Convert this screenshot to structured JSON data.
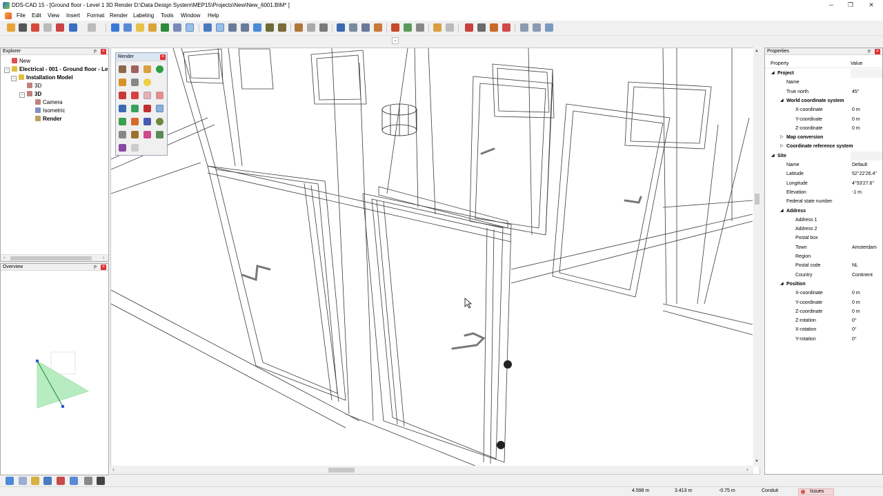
{
  "window": {
    "title": "DDS-CAD 15 - [Ground floor - Level 1  3D  Render  D:\\Data Design System\\MEP15\\Projects\\New\\New_6001.BIM* ]",
    "controls": [
      "─",
      "❐",
      "✕"
    ]
  },
  "menu": [
    "File",
    "Edit",
    "View",
    "Insert",
    "Format",
    "Render",
    "Labeling",
    "Tools",
    "Window",
    "Help"
  ],
  "explorer": {
    "title": "Explorer",
    "tree": [
      {
        "label": "New",
        "level": 0,
        "icon": "new-project-icon"
      },
      {
        "label": "Electrical - 001 - Ground floor - Le",
        "level": 0,
        "icon": "electrical-model-icon",
        "bold": true
      },
      {
        "label": "Installation Model",
        "level": 1,
        "icon": "installation-model-icon",
        "bold": true
      },
      {
        "label": "3D",
        "level": 2,
        "icon": "view-3d-icon"
      },
      {
        "label": "3D",
        "level": 2,
        "icon": "view-3d-icon",
        "bold": true
      },
      {
        "label": "Camera",
        "level": 3,
        "icon": "camera-icon"
      },
      {
        "label": "Isometric",
        "level": 3,
        "icon": "isometric-icon"
      },
      {
        "label": "Render",
        "level": 3,
        "icon": "render-icon",
        "bold": true
      }
    ]
  },
  "overview": {
    "title": "Overview"
  },
  "render_palette": {
    "title": "Render"
  },
  "properties": {
    "title": "Properties",
    "col_property": "Property",
    "col_value": "Value",
    "rows": [
      {
        "label": "Project",
        "level": 0,
        "section": true,
        "value": ""
      },
      {
        "label": "Name",
        "level": 1,
        "value": ""
      },
      {
        "label": "True north",
        "level": 1,
        "value": "45°"
      },
      {
        "label": "World coordinate system",
        "level": 1,
        "section": true,
        "value": ""
      },
      {
        "label": "X-coordinate",
        "level": 2,
        "value": "0 m"
      },
      {
        "label": "Y-coordinate",
        "level": 2,
        "value": "0 m"
      },
      {
        "label": "Z-coordinate",
        "level": 2,
        "value": "0 m"
      },
      {
        "label": "Map conversion",
        "level": 1,
        "section": true,
        "collapsed": true,
        "value": ""
      },
      {
        "label": "Coordinate reference system",
        "level": 1,
        "section": true,
        "collapsed": true,
        "value": ""
      },
      {
        "label": "Site",
        "level": 0,
        "section": true,
        "value": ""
      },
      {
        "label": "Name",
        "level": 1,
        "value": "Default"
      },
      {
        "label": "Latitude",
        "level": 1,
        "value": "52°22'26.4\""
      },
      {
        "label": "Longitude",
        "level": 1,
        "value": "4°53'27.6\""
      },
      {
        "label": "Elevation",
        "level": 1,
        "value": "-1 m"
      },
      {
        "label": "Federal state number",
        "level": 1,
        "value": ""
      },
      {
        "label": "Address",
        "level": 1,
        "section": true,
        "value": ""
      },
      {
        "label": "Address 1",
        "level": 2,
        "value": ""
      },
      {
        "label": "Address 2",
        "level": 2,
        "value": ""
      },
      {
        "label": "Postal box",
        "level": 2,
        "value": ""
      },
      {
        "label": "Town",
        "level": 2,
        "value": "Amsterdam"
      },
      {
        "label": "Region",
        "level": 2,
        "value": ""
      },
      {
        "label": "Postal code",
        "level": 2,
        "value": "NL"
      },
      {
        "label": "Country",
        "level": 2,
        "value": "Continent"
      },
      {
        "label": "Position",
        "level": 1,
        "section": true,
        "value": ""
      },
      {
        "label": "X-coordinate",
        "level": 2,
        "value": "0 m"
      },
      {
        "label": "Y-coordinate",
        "level": 2,
        "value": "0 m"
      },
      {
        "label": "Z-coordinate",
        "level": 2,
        "value": "0 m"
      },
      {
        "label": "Z-rotation",
        "level": 2,
        "value": "0°"
      },
      {
        "label": "X-rotation",
        "level": 2,
        "value": "0°"
      },
      {
        "label": "Y-rotation",
        "level": 2,
        "value": "0°"
      }
    ]
  },
  "status": {
    "x": "4.598 m",
    "y": "3.413 m",
    "z": "-0.75 m",
    "layer": "Conduit",
    "issues": "Issues"
  },
  "colors": {
    "accent": "#2a72c9",
    "model_lines": "#3a3a3a",
    "overview_triangle": "#9fe0a8",
    "issues_badge": "#d9534f"
  }
}
